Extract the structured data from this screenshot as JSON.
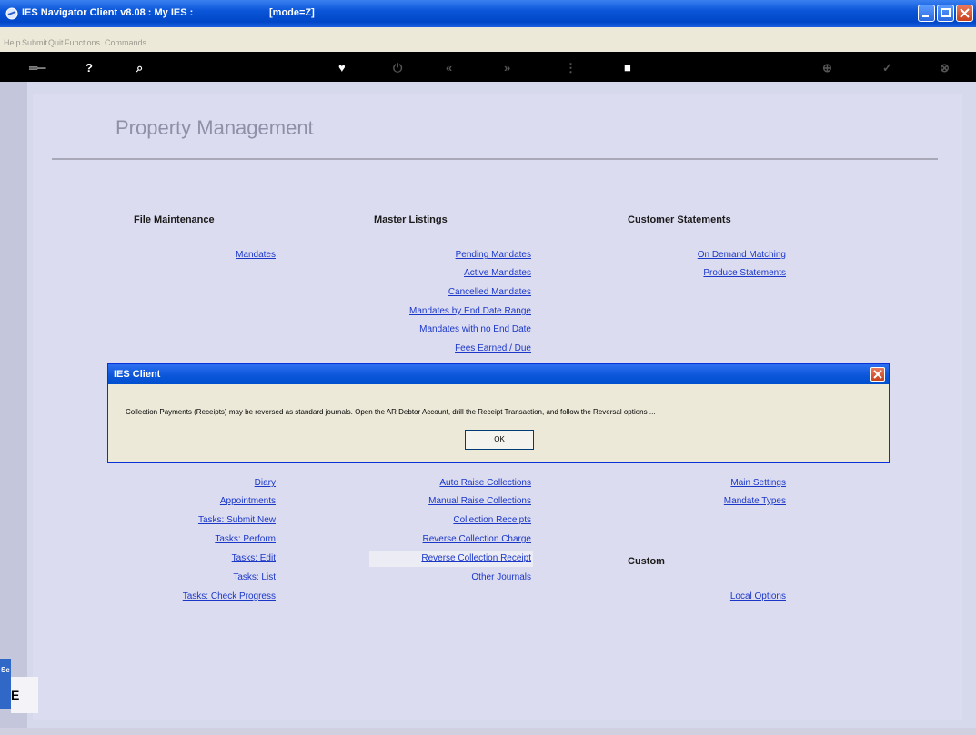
{
  "window": {
    "title": "IES Navigator Client v8.08 : My IES :",
    "mode": "[mode=Z]"
  },
  "menu": [
    "Help",
    "Submit",
    "Quit",
    "Functions",
    "Commands"
  ],
  "page": {
    "heading": "Property Management"
  },
  "sections": {
    "file_maintenance": {
      "title": "File Maintenance",
      "links": [
        "Mandates"
      ]
    },
    "master_listings": {
      "title": "Master Listings",
      "links": [
        "Pending Mandates",
        "Active Mandates",
        "Cancelled Mandates",
        "Mandates by End Date Range",
        "Mandates with no End Date",
        "Fees Earned / Due"
      ]
    },
    "customer_statements": {
      "title": "Customer Statements",
      "links": [
        "On Demand Matching",
        "Produce Statements"
      ]
    },
    "lower_left": {
      "links": [
        "Diary",
        "Appointments",
        "Tasks: Submit New",
        "Tasks: Perform",
        "Tasks: Edit",
        "Tasks: List",
        "Tasks: Check Progress"
      ]
    },
    "lower_middle": {
      "links": [
        "Auto Raise Collections",
        "Manual Raise Collections",
        "Collection Receipts",
        "Reverse Collection Charge",
        "Reverse Collection Receipt",
        "Other Journals"
      ]
    },
    "lower_right": {
      "links": [
        "Main Settings",
        "Mandate Types"
      ]
    },
    "custom": {
      "title": "Custom",
      "links": [
        "Local Options"
      ]
    }
  },
  "dialog": {
    "title": "IES Client",
    "message": "Collection Payments (Receipts) may be reversed as standard journals. Open the AR Debtor Account, drill the Receipt Transaction, and follow the Reversal options ...",
    "ok_label": "OK"
  },
  "side": {
    "tab_label": "Se",
    "letter": "E"
  }
}
